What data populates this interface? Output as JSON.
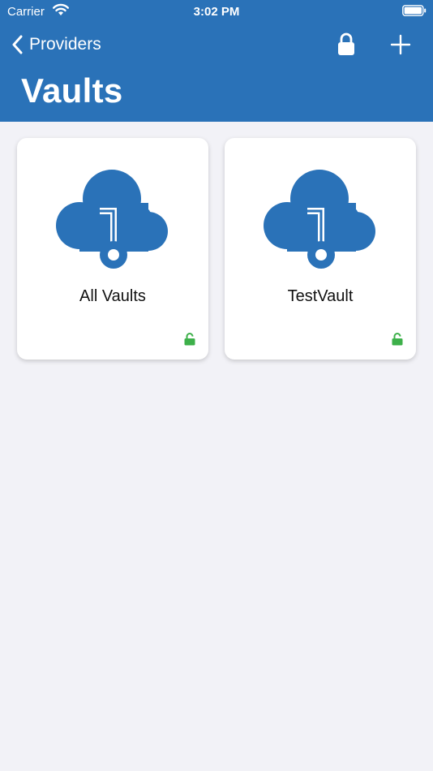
{
  "status": {
    "carrier": "Carrier",
    "time": "3:02 PM"
  },
  "nav": {
    "back_label": "Providers",
    "title": "Vaults"
  },
  "vaults": [
    {
      "name": "All Vaults",
      "locked": false
    },
    {
      "name": "TestVault",
      "locked": false
    }
  ],
  "colors": {
    "header": "#2a72b8",
    "background": "#f2f2f7",
    "unlocked": "#3db04a",
    "cloud": "#2a72b8"
  }
}
